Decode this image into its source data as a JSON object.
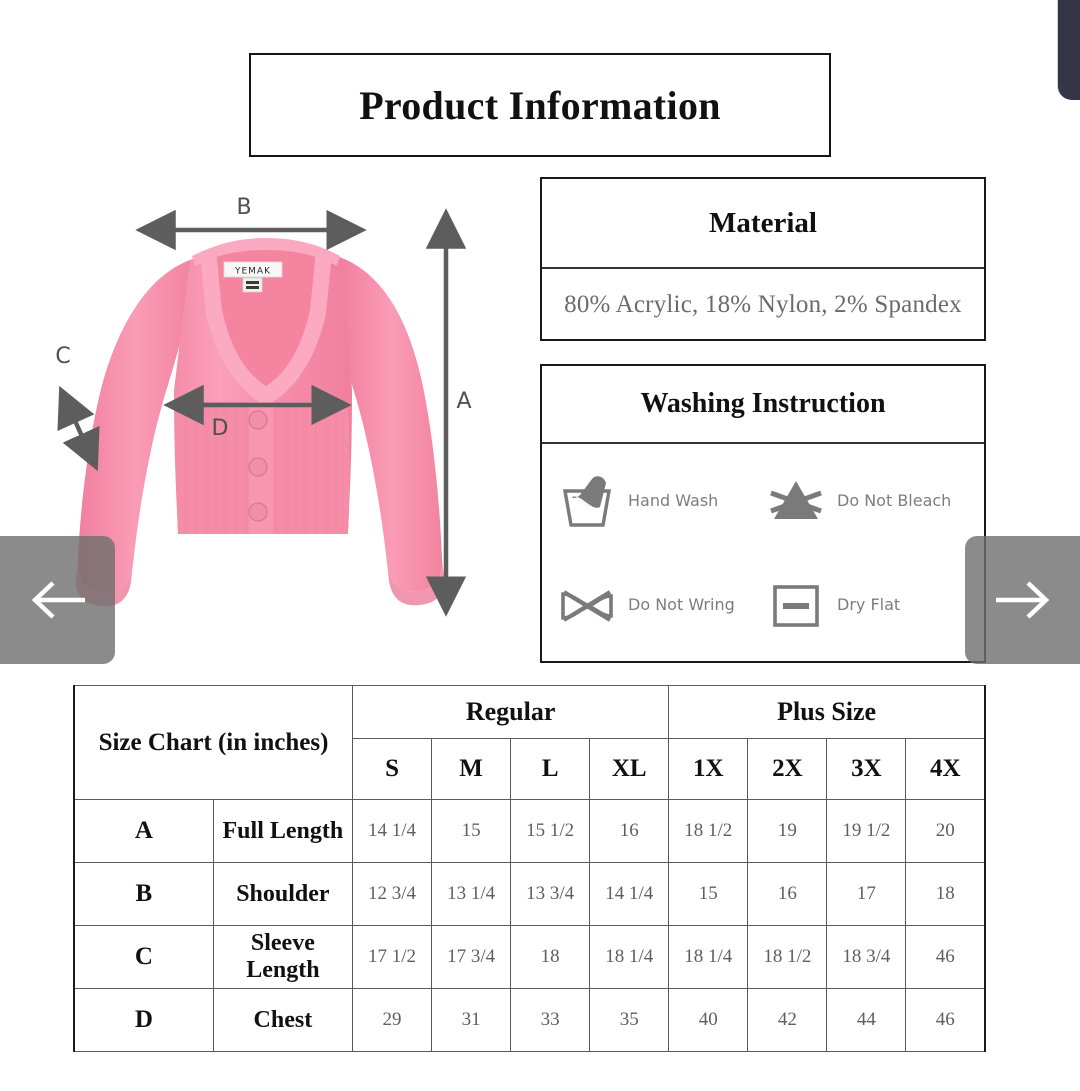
{
  "page": {
    "title": "Product Information"
  },
  "garment": {
    "brand_label": "YEMAK",
    "color": "#f78ba8",
    "measure_labels": {
      "a": "A",
      "b": "B",
      "c": "C",
      "d": "D"
    }
  },
  "material": {
    "heading": "Material",
    "value": "80% Acrylic, 18% Nylon, 2% Spandex"
  },
  "washing": {
    "heading": "Washing Instruction",
    "items": [
      {
        "icon": "hand-wash-icon",
        "label": "Hand Wash"
      },
      {
        "icon": "do-not-bleach-icon",
        "label": "Do Not Bleach"
      },
      {
        "icon": "do-not-wring-icon",
        "label": "Do Not Wring"
      },
      {
        "icon": "dry-flat-icon",
        "label": "Dry Flat"
      }
    ]
  },
  "size_chart": {
    "title": "Size Chart (in inches)",
    "groups": [
      {
        "label": "Regular",
        "sizes": [
          "S",
          "M",
          "L",
          "XL"
        ]
      },
      {
        "label": "Plus Size",
        "sizes": [
          "1X",
          "2X",
          "3X",
          "4X"
        ]
      }
    ],
    "columns": [
      "S",
      "M",
      "L",
      "XL",
      "1X",
      "2X",
      "3X",
      "4X"
    ],
    "rows": [
      {
        "letter": "A",
        "name": "Full Length",
        "values": [
          "14 1/4",
          "15",
          "15 1/2",
          "16",
          "18 1/2",
          "19",
          "19 1/2",
          "20"
        ]
      },
      {
        "letter": "B",
        "name": "Shoulder",
        "values": [
          "12 3/4",
          "13 1/4",
          "13 3/4",
          "14 1/4",
          "15",
          "16",
          "17",
          "18"
        ]
      },
      {
        "letter": "C",
        "name": "Sleeve Length",
        "values": [
          "17 1/2",
          "17 3/4",
          "18",
          "18 1/4",
          "18 1/4",
          "18 1/2",
          "18 3/4",
          "46"
        ]
      },
      {
        "letter": "D",
        "name": "Chest",
        "values": [
          "29",
          "31",
          "33",
          "35",
          "40",
          "42",
          "44",
          "46"
        ]
      }
    ]
  },
  "nav": {
    "prev_icon": "arrow-left-icon",
    "next_icon": "arrow-right-icon"
  },
  "colors": {
    "border": "#1a1a1a",
    "icon_gray": "#7a7a7a",
    "value_gray": "#5f5f5f",
    "garment_pink": "#f78ba8"
  }
}
